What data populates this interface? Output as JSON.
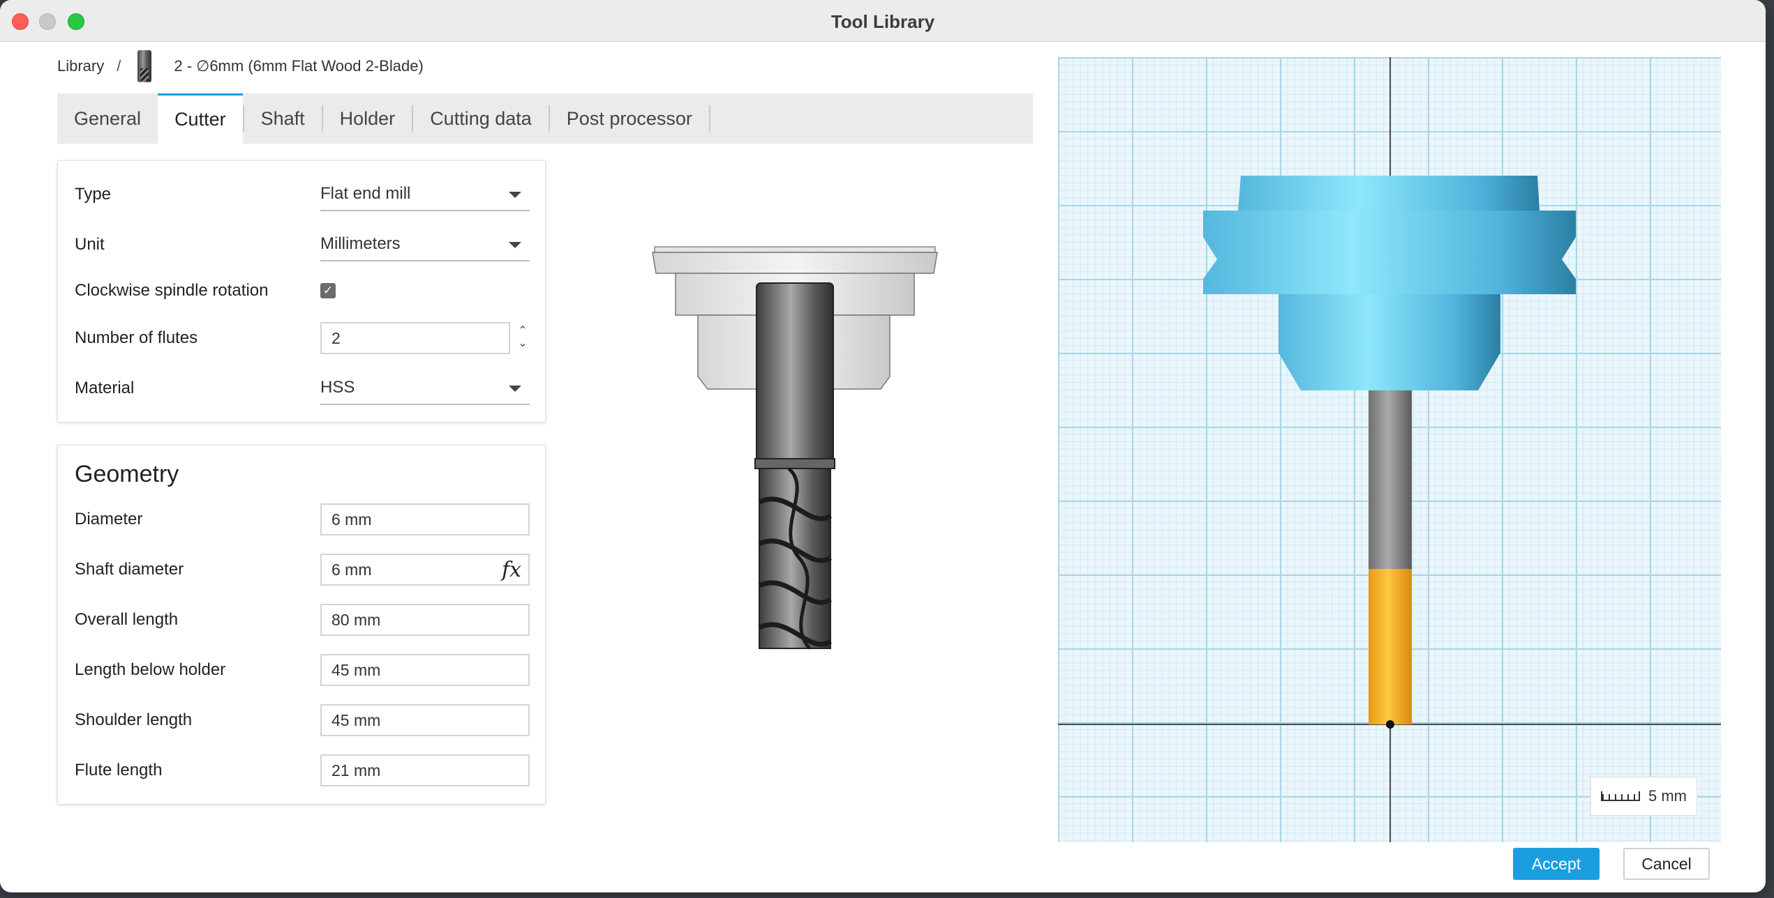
{
  "window": {
    "title": "Tool Library"
  },
  "breadcrumb": {
    "root": "Library",
    "separator": "/",
    "current": "2 - ∅6mm (6mm Flat Wood 2-Blade)"
  },
  "tabs": [
    {
      "label": "General",
      "active": false
    },
    {
      "label": "Cutter",
      "active": true
    },
    {
      "label": "Shaft",
      "active": false
    },
    {
      "label": "Holder",
      "active": false
    },
    {
      "label": "Cutting data",
      "active": false
    },
    {
      "label": "Post processor",
      "active": false
    }
  ],
  "cutter": {
    "type": {
      "label": "Type",
      "value": "Flat end mill"
    },
    "unit": {
      "label": "Unit",
      "value": "Millimeters"
    },
    "clockwise": {
      "label": "Clockwise spindle rotation",
      "checked": true,
      "glyph": "✓"
    },
    "flutes": {
      "label": "Number of flutes",
      "value": "2",
      "up": "⌃",
      "down": "⌄"
    },
    "material": {
      "label": "Material",
      "value": "HSS"
    }
  },
  "geometry": {
    "title": "Geometry",
    "fx_symbol": "fx",
    "fields": [
      {
        "label": "Diameter",
        "value": "6 mm"
      },
      {
        "label": "Shaft diameter",
        "value": "6 mm"
      },
      {
        "label": "Overall length",
        "value": "80 mm"
      },
      {
        "label": "Length below holder",
        "value": "45 mm"
      },
      {
        "label": "Shoulder length",
        "value": "45 mm"
      },
      {
        "label": "Flute length",
        "value": "21 mm"
      }
    ]
  },
  "viewport": {
    "scale_label": "5 mm",
    "holder_color": "#5cc6ee",
    "shaft_color": "#8a8a8a",
    "flute_color": "#f5b52a"
  },
  "buttons": {
    "accept": "Accept",
    "cancel": "Cancel"
  }
}
